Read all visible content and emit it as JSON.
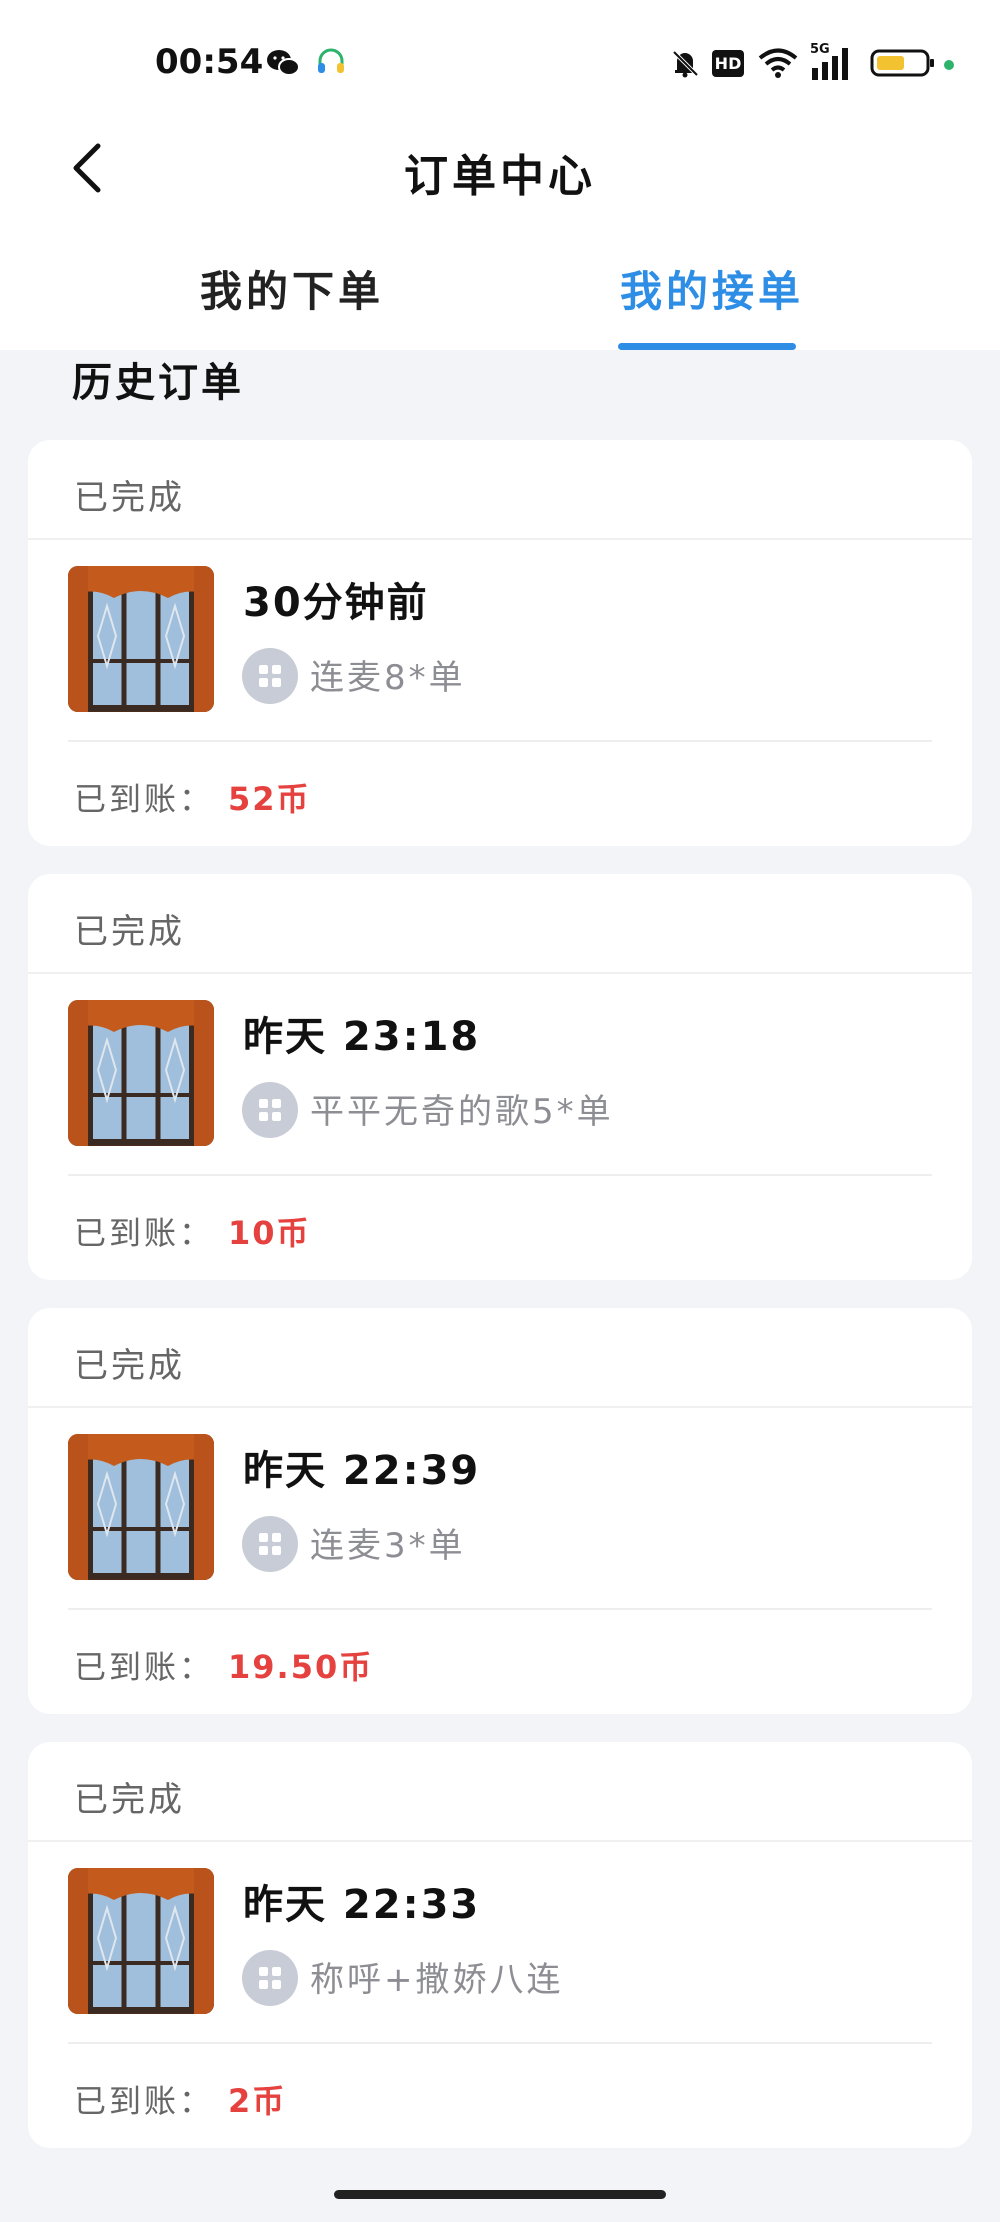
{
  "status_bar": {
    "time": "00:54",
    "icons": [
      "wechat-icon",
      "headset-icon",
      "mute-bell-icon",
      "hd-icon",
      "wifi-icon",
      "signal-5g-icon",
      "battery-icon"
    ],
    "hd_text": "HD",
    "network": "5G"
  },
  "header": {
    "title": "订单中心",
    "tabs": [
      "我的下单",
      "我的接单"
    ],
    "active_tab_color": "#2e8ee6"
  },
  "section_title": "历史订单",
  "orders": [
    {
      "status": "已完成",
      "time": "30分钟前",
      "item": "连麦8*单",
      "paid_label": "已到账：",
      "amount": "52币"
    },
    {
      "status": "已完成",
      "time": "昨天 23:18",
      "item": "平平无奇的歌5*单",
      "paid_label": "已到账：",
      "amount": "10币"
    },
    {
      "status": "已完成",
      "time": "昨天 22:39",
      "item": "连麦3*单",
      "paid_label": "已到账：",
      "amount": "19.50币"
    },
    {
      "status": "已完成",
      "time": "昨天 22:33",
      "item": "称呼+撒娇八连",
      "paid_label": "已到账：",
      "amount": "2币"
    }
  ],
  "colors": {
    "accent_blue": "#2e8ee6",
    "amount_red": "#e5413e",
    "background": "#f2f4f8"
  }
}
